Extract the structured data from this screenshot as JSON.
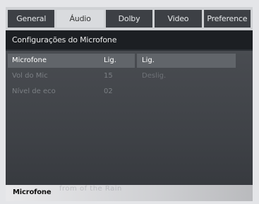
{
  "tabs": [
    {
      "label": "General",
      "active": false
    },
    {
      "label": "Áudio",
      "active": true
    },
    {
      "label": "Dolby",
      "active": false
    },
    {
      "label": "Video",
      "active": false
    },
    {
      "label": "Preference",
      "active": false
    }
  ],
  "section": {
    "title": "Configurações do Microfone"
  },
  "settings": [
    {
      "label": "Microfone",
      "value": "Lig.",
      "selected": true
    },
    {
      "label": "Vol do Mic",
      "value": "15",
      "selected": false
    },
    {
      "label": "Nível de eco",
      "value": "02",
      "selected": false
    }
  ],
  "options": [
    {
      "label": "Lig.",
      "selected": true
    },
    {
      "label": "Deslig.",
      "selected": false
    }
  ],
  "footer": {
    "label": "Microfone",
    "background_text": "from of the Rain"
  },
  "colors": {
    "selected_bg": "#61656a",
    "panel_bg": "#3e4146",
    "tab_active_bg": "#d9dbde"
  }
}
